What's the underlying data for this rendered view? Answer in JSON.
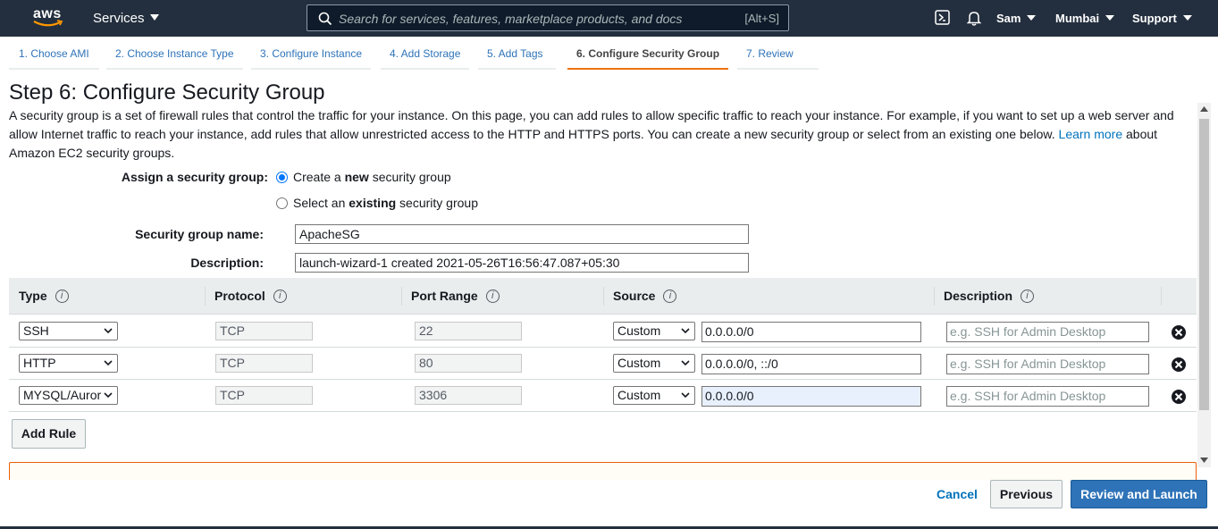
{
  "topnav": {
    "logo_text": "aws",
    "services_label": "Services",
    "search_placeholder": "Search for services, features, marketplace products, and docs",
    "search_shortcut": "[Alt+S]",
    "user": "Sam",
    "region": "Mumbai",
    "support": "Support",
    "icons": [
      "terminal-icon",
      "bell-icon"
    ]
  },
  "wizard_tabs": [
    {
      "label": "1. Choose AMI",
      "active": false
    },
    {
      "label": "2. Choose Instance Type",
      "active": false
    },
    {
      "label": "3. Configure Instance",
      "active": false
    },
    {
      "label": "4. Add Storage",
      "active": false
    },
    {
      "label": "5. Add Tags",
      "active": false
    },
    {
      "label": "6. Configure Security Group",
      "active": true
    },
    {
      "label": "7. Review",
      "active": false
    }
  ],
  "page": {
    "title": "Step 6: Configure Security Group",
    "intro_text": "A security group is a set of firewall rules that control the traffic for your instance. On this page, you can add rules to allow specific traffic to reach your instance. For example, if you want to set up a web server and allow Internet traffic to reach your instance, add rules that allow unrestricted access to the HTTP and HTTPS ports. You can create a new security group or select from an existing one below.",
    "learn_more": "Learn more",
    "intro_suffix": "about Amazon EC2 security groups."
  },
  "form": {
    "assign_label": "Assign a security group:",
    "option_new_pre": "Create a ",
    "option_new_bold": "new",
    "option_new_post": " security group",
    "option_existing_pre": "Select an ",
    "option_existing_bold": "existing",
    "option_existing_post": " security group",
    "selected": "new",
    "name_label": "Security group name:",
    "name_value": "ApacheSG",
    "desc_label": "Description:",
    "desc_value": "launch-wizard-1 created 2021-05-26T16:56:47.087+05:30"
  },
  "rules_table": {
    "headers": [
      "Type",
      "Protocol",
      "Port Range",
      "Source",
      "Description"
    ],
    "info_glyph": "i",
    "rows": [
      {
        "type": "SSH",
        "protocol": "TCP",
        "port": "22",
        "source_mode": "Custom",
        "cidr": "0.0.0.0/0",
        "desc_placeholder": "e.g. SSH for Admin Desktop"
      },
      {
        "type": "HTTP",
        "protocol": "TCP",
        "port": "80",
        "source_mode": "Custom",
        "cidr": "0.0.0.0/0, ::/0",
        "desc_placeholder": "e.g. SSH for Admin Desktop"
      },
      {
        "type": "MYSQL/Auror",
        "protocol": "TCP",
        "port": "3306",
        "source_mode": "Custom",
        "cidr": "0.0.0.0/0",
        "desc_placeholder": "e.g. SSH for Admin Desktop"
      }
    ],
    "add_rule": "Add Rule"
  },
  "footer": {
    "cancel": "Cancel",
    "previous": "Previous",
    "review_launch": "Review and Launch"
  },
  "colors": {
    "nav_bg": "#232f3e",
    "link": "#0073bb",
    "active_tab_underline": "#ec7211",
    "primary_button": "#2e73b8"
  }
}
